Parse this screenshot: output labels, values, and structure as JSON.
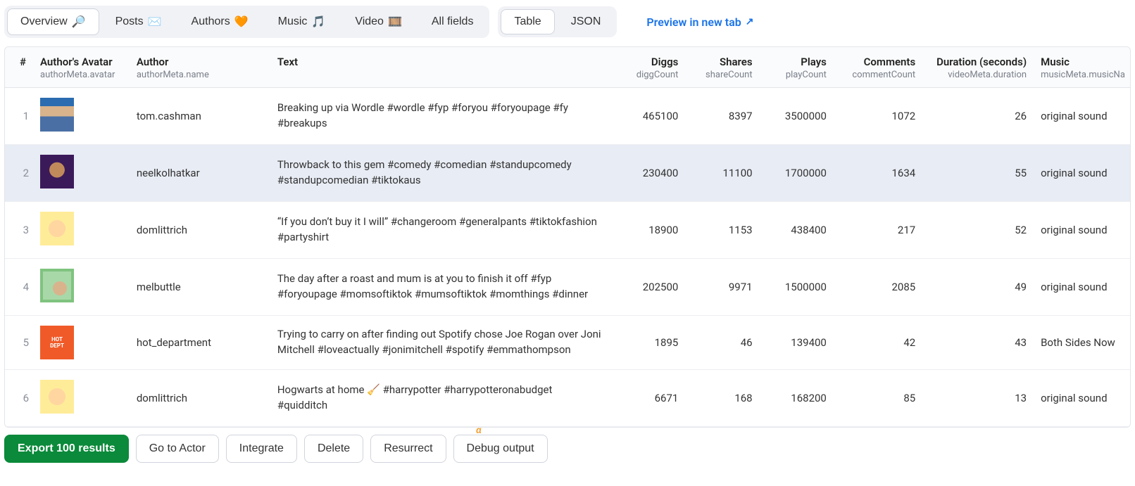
{
  "tabs1": {
    "overview": "Overview",
    "overview_icon": "🔎",
    "posts": "Posts",
    "posts_icon": "✉️",
    "authors": "Authors",
    "authors_icon": "🧡",
    "music": "Music",
    "music_icon": "🎵",
    "video": "Video",
    "video_icon": "🎞️",
    "allfields": "All fields"
  },
  "tabs2": {
    "table": "Table",
    "json": "JSON"
  },
  "preview": "Preview in new tab",
  "columns": {
    "idx": "#",
    "avatar": "Author's Avatar",
    "avatar_sub": "authorMeta.avatar",
    "author": "Author",
    "author_sub": "authorMeta.name",
    "text": "Text",
    "diggs": "Diggs",
    "diggs_sub": "diggCount",
    "shares": "Shares",
    "shares_sub": "shareCount",
    "plays": "Plays",
    "plays_sub": "playCount",
    "comments": "Comments",
    "comments_sub": "commentCount",
    "duration": "Duration (seconds)",
    "duration_sub": "videoMeta.duration",
    "music": "Music",
    "music_sub": "musicMeta.musicNa"
  },
  "rows": [
    {
      "idx": "1",
      "author": "tom.cashman",
      "text": "Breaking up via Wordle #wordle #fyp #foryou #foryoupage #fy #breakups",
      "diggs": "465100",
      "shares": "8397",
      "plays": "3500000",
      "comments": "1072",
      "duration": "26",
      "music": "original sound",
      "av": "av1"
    },
    {
      "idx": "2",
      "author": "neelkolhatkar",
      "text": "Throwback to this gem #comedy #comedian #standupcomedy #standupcomedian #tiktokaus",
      "diggs": "230400",
      "shares": "11100",
      "plays": "1700000",
      "comments": "1634",
      "duration": "55",
      "music": "original sound",
      "av": "av2",
      "hover": true
    },
    {
      "idx": "3",
      "author": "domlittrich",
      "text": "“If you don’t buy it I will” #changeroom #generalpants #tiktokfashion #partyshirt",
      "diggs": "18900",
      "shares": "1153",
      "plays": "438400",
      "comments": "217",
      "duration": "52",
      "music": "original sound",
      "av": "av3"
    },
    {
      "idx": "4",
      "author": "melbuttle",
      "text": "The day after a roast and mum is at you to finish it off #fyp #foryoupage #momsoftiktok #mumsoftiktok #momthings #dinner",
      "diggs": "202500",
      "shares": "9971",
      "plays": "1500000",
      "comments": "2085",
      "duration": "49",
      "music": "original sound",
      "av": "av4"
    },
    {
      "idx": "5",
      "author": "hot_department",
      "text": "Trying to carry on after finding out Spotify chose Joe Rogan over Joni Mitchell #loveactually #jonimitchell #spotify #emmathompson",
      "diggs": "1895",
      "shares": "46",
      "plays": "139400",
      "comments": "42",
      "duration": "43",
      "music": "Both Sides Now",
      "av": "av5"
    },
    {
      "idx": "6",
      "author": "domlittrich",
      "text": "Hogwarts at home 🧹 #harrypotter #harrypotteronabudget #quidditch",
      "diggs": "6671",
      "shares": "168",
      "plays": "168200",
      "comments": "85",
      "duration": "13",
      "music": "original sound",
      "av": "av3"
    }
  ],
  "alpha": "α",
  "buttons": {
    "export": "Export 100 results",
    "goto": "Go to Actor",
    "integrate": "Integrate",
    "delete": "Delete",
    "resurrect": "Resurrect",
    "debug": "Debug output"
  }
}
